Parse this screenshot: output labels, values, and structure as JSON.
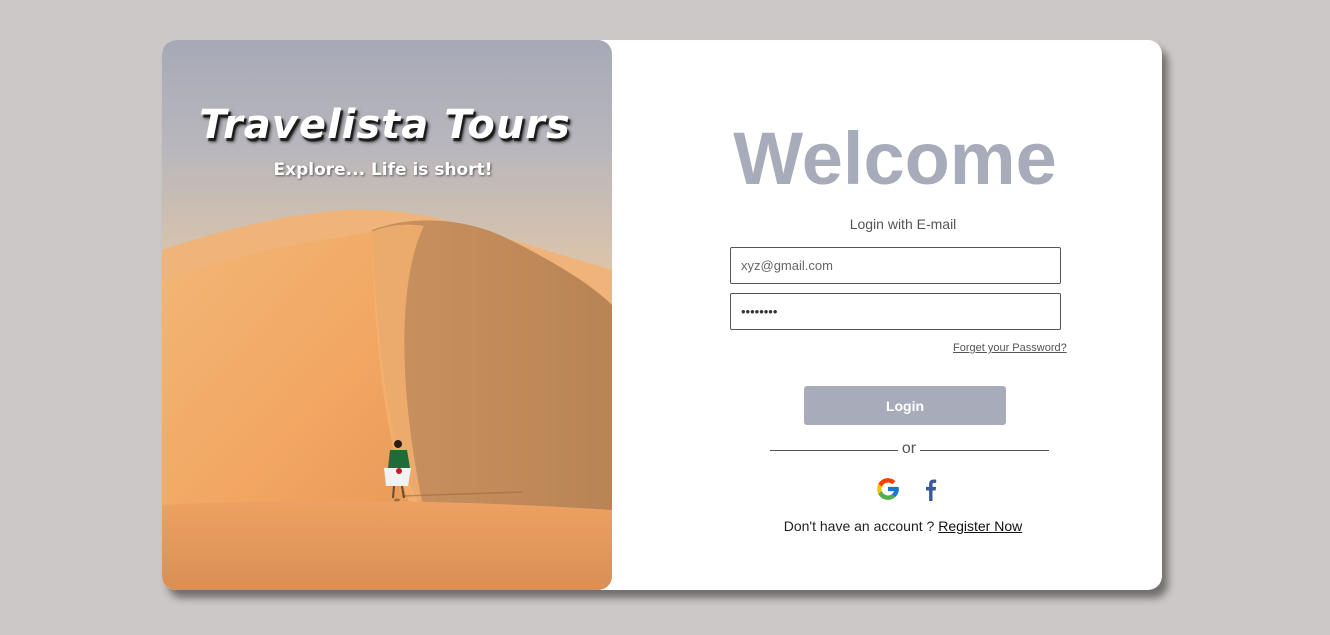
{
  "brand": {
    "title": "Travelista Tours",
    "tagline": "Explore... Life is short!"
  },
  "login": {
    "heading": "Welcome",
    "subtitle": "Login with E-mail",
    "email_placeholder": "xyz@gmail.com",
    "password_value": "12345678",
    "forgot_label": "Forget your Password?",
    "login_label": "Login",
    "divider_text": "or",
    "no_account_text": "Don't have an account ?",
    "register_label": "Register Now"
  },
  "social": [
    {
      "name": "google-icon"
    },
    {
      "name": "facebook-icon"
    }
  ],
  "colors": {
    "page_background": "#cdc8c8",
    "accent": "#a8acba",
    "card": "#ffffff",
    "facebook_blue": "#3b5998"
  }
}
